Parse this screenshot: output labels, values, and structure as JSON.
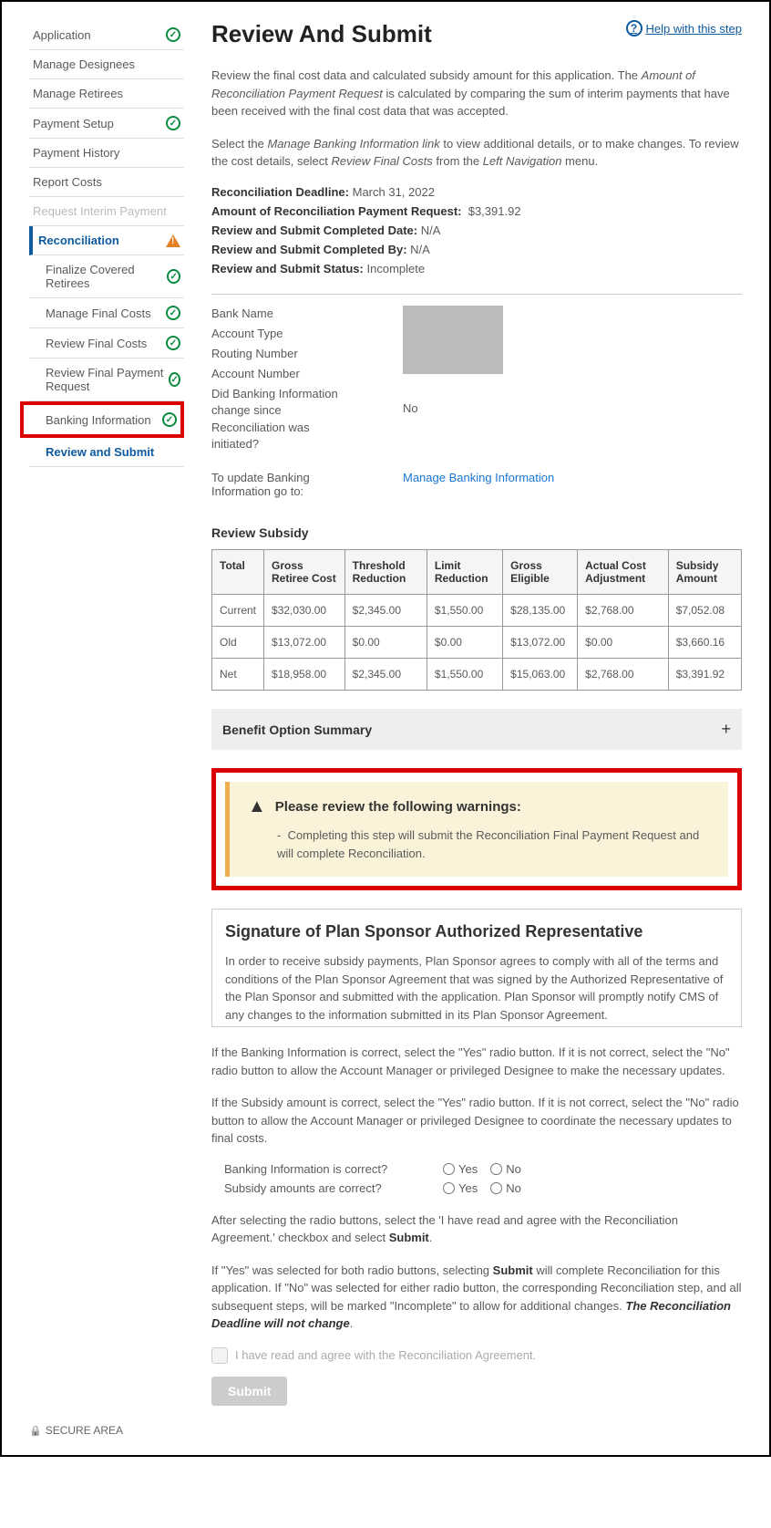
{
  "header": {
    "title": "Review And Submit",
    "help_label": " Help with this step"
  },
  "sidebar": {
    "items": [
      {
        "label": "Application",
        "icon": "check"
      },
      {
        "label": "Manage Designees",
        "icon": null
      },
      {
        "label": "Manage Retirees",
        "icon": null
      },
      {
        "label": "Payment Setup",
        "icon": "check"
      },
      {
        "label": "Payment History",
        "icon": null
      },
      {
        "label": "Report Costs",
        "icon": null
      },
      {
        "label": "Request Interim Payment",
        "icon": null,
        "disabled": true
      },
      {
        "label": "Reconciliation",
        "icon": "warn",
        "active": true
      },
      {
        "label": "Finalize Covered Retirees",
        "icon": "check",
        "sub": true
      },
      {
        "label": "Manage Final Costs",
        "icon": "check",
        "sub": true
      },
      {
        "label": "Review Final Costs",
        "icon": "check",
        "sub": true
      },
      {
        "label": "Review Final Payment Request",
        "icon": "check",
        "sub": true
      },
      {
        "label": "Banking Information",
        "icon": "check",
        "sub": true,
        "red": true
      },
      {
        "label": "Review and Submit",
        "bold": true,
        "sub": true
      }
    ]
  },
  "intro": {
    "p1a": "Review the final cost data and calculated subsidy amount for this application. The ",
    "p1b": "Amount of Reconciliation Payment Request",
    "p1c": " is calculated by comparing the sum of interim payments that have been received with the final cost data that was accepted.",
    "p2a": "Select the ",
    "p2b": "Manage Banking Information link",
    "p2c": " to view additional details, or to make changes. To review the cost details, select ",
    "p2d": "Review Final Costs",
    "p2e": " from the ",
    "p2f": "Left Navigation",
    "p2g": " menu."
  },
  "info": {
    "deadline_label": "Reconciliation Deadline:",
    "deadline_value": "March 31, 2022",
    "amount_label": "Amount of Reconciliation Payment Request:",
    "amount_value": "$3,391.92",
    "completed_date_label": "Review and Submit Completed Date:",
    "completed_date_value": "N/A",
    "completed_by_label": "Review and Submit Completed By:",
    "completed_by_value": "N/A",
    "status_label": "Review and Submit Status:",
    "status_value": "Incomplete"
  },
  "bank": {
    "l1": "Bank Name",
    "l2": "Account Type",
    "l3": "Routing Number",
    "l4": "Account Number",
    "l5": "Did Banking Information change since Reconciliation was initiated?",
    "no": "No",
    "update_label": "To update Banking Information go to:",
    "update_link": "Manage Banking Information"
  },
  "subsidy": {
    "title": "Review Subsidy",
    "headers": [
      "Total",
      "Gross Retiree Cost",
      "Threshold Reduction",
      "Limit Reduction",
      "Gross Eligible",
      "Actual Cost Adjustment",
      "Subsidy Amount"
    ],
    "rows": [
      [
        "Current",
        "$32,030.00",
        "$2,345.00",
        "$1,550.00",
        "$28,135.00",
        "$2,768.00",
        "$7,052.08"
      ],
      [
        "Old",
        "$13,072.00",
        "$0.00",
        "$0.00",
        "$13,072.00",
        "$0.00",
        "$3,660.16"
      ],
      [
        "Net",
        "$18,958.00",
        "$2,345.00",
        "$1,550.00",
        "$15,063.00",
        "$2,768.00",
        "$3,391.92"
      ]
    ]
  },
  "accordion": {
    "title": "Benefit Option Summary"
  },
  "warnings": {
    "title": "Please review the following warnings:",
    "item": "Completing this step will submit the Reconciliation Final Payment Request and will complete Reconciliation."
  },
  "signature": {
    "title": "Signature of Plan Sponsor Authorized Representative",
    "body": "In order to receive subsidy payments, Plan Sponsor agrees to comply with all of the terms and conditions of the Plan Sponsor Agreement that was signed by the Authorized Representative of the Plan Sponsor and submitted with the application. Plan Sponsor will promptly notify CMS of any changes to the information submitted in its Plan Sponsor Agreement."
  },
  "instructions": {
    "p1": "If the Banking Information is correct, select the \"Yes\" radio button. If it is not correct, select the \"No\" radio button to allow the Account Manager or privileged Designee to make the necessary updates.",
    "p2": "If the Subsidy amount is correct, select the \"Yes\" radio button. If it is not correct, select the \"No\" radio button to allow the Account Manager or privileged Designee to coordinate the necessary updates to final costs."
  },
  "radios": {
    "q1": "Banking Information is correct?",
    "q2": "Subsidy amounts are correct?",
    "yes": "Yes",
    "no": "No"
  },
  "post": {
    "p1a": "After selecting the radio buttons, select the 'I have read and agree with the Reconciliation Agreement.' checkbox and select ",
    "p1b": "Submit",
    "p1c": ".",
    "p2a": "If \"Yes\" was selected for both radio buttons, selecting ",
    "p2b": "Submit",
    "p2c": " will complete Reconciliation for this application. If \"No\" was selected for either radio button, the corresponding Reconciliation step, and all subsequent steps, will be marked \"Incomplete\" to allow for additional changes. ",
    "p2d": "The Reconciliation Deadline will not change",
    "p2e": "."
  },
  "agree": {
    "label": "I have read and agree with the Reconciliation Agreement."
  },
  "submit": {
    "label": "Submit"
  },
  "secure": {
    "label": "SECURE AREA"
  }
}
